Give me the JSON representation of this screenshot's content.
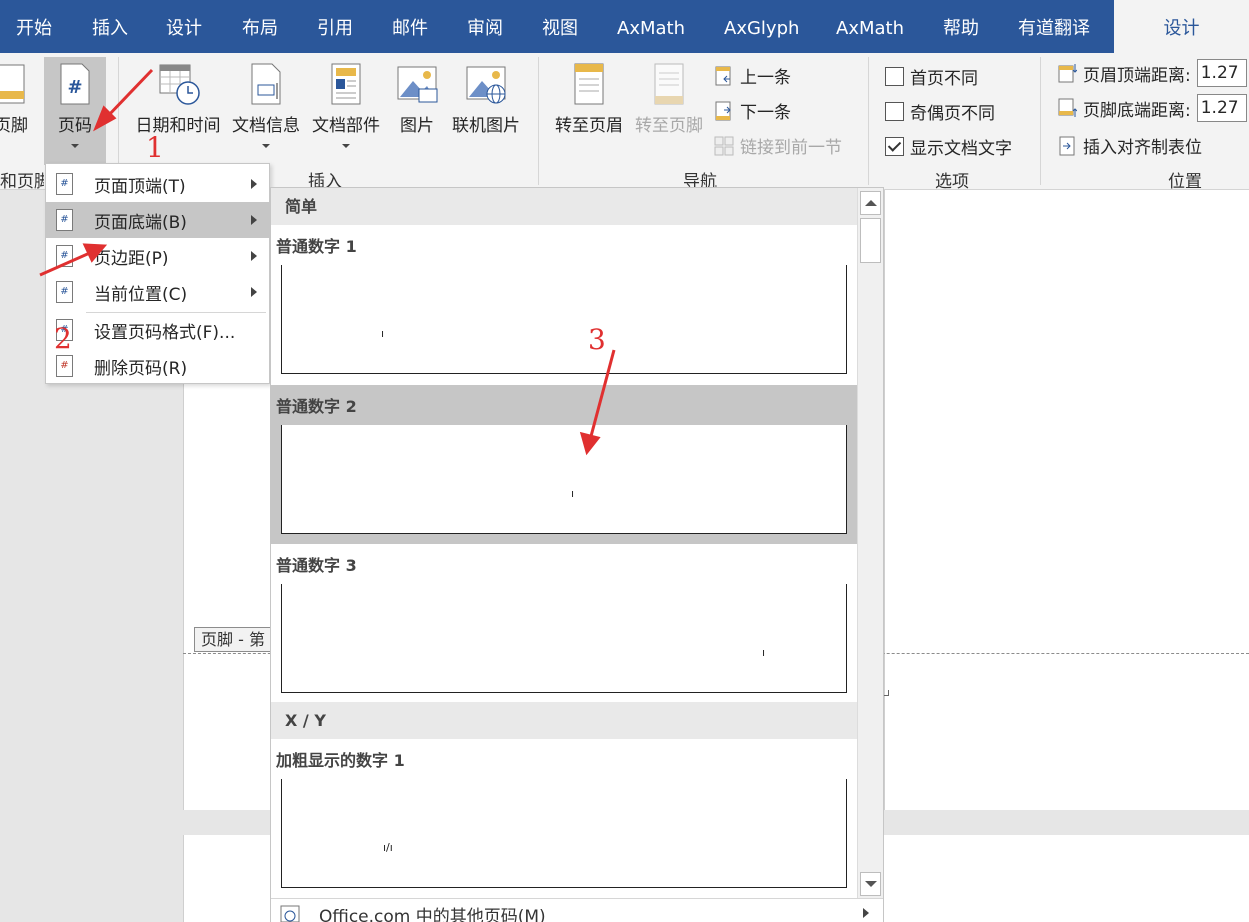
{
  "tabs": [
    {
      "label": "开始",
      "active": false
    },
    {
      "label": "插入",
      "active": false
    },
    {
      "label": "设计",
      "active": false
    },
    {
      "label": "布局",
      "active": false
    },
    {
      "label": "引用",
      "active": false
    },
    {
      "label": "邮件",
      "active": false
    },
    {
      "label": "审阅",
      "active": false
    },
    {
      "label": "视图",
      "active": false
    },
    {
      "label": "AxMath",
      "active": false
    },
    {
      "label": "AxGlyph",
      "active": false
    },
    {
      "label": "AxMath",
      "active": false
    },
    {
      "label": "帮助",
      "active": false
    },
    {
      "label": "有道翻译",
      "active": false
    },
    {
      "label": "设计",
      "active": true
    }
  ],
  "ribbon": {
    "footer_btn": "页脚",
    "page_number_btn": "页码",
    "page_number_icon_glyph": "#",
    "group_header_footer": "和页脚",
    "date_time_btn": "日期和时间",
    "doc_info_btn": "文档信息",
    "doc_parts_btn": "文档部件",
    "picture_btn": "图片",
    "online_picture_btn": "联机图片",
    "group_insert": "插入",
    "goto_header_btn": "转至页眉",
    "goto_footer_btn": "转至页脚",
    "prev_btn": "上一条",
    "next_btn": "下一条",
    "link_prev_btn": "链接到前一节",
    "group_nav": "导航",
    "opt_first_page": "首页不同",
    "opt_odd_even": "奇偶页不同",
    "opt_show_doc_text": "显示文档文字",
    "opt_first_page_checked": false,
    "opt_odd_even_checked": false,
    "opt_show_doc_text_checked": true,
    "group_options": "选项",
    "header_top_label": "页眉顶端距离:",
    "header_top_value": "1.27",
    "footer_bottom_label": "页脚底端距离:",
    "footer_bottom_value": "1.27",
    "insert_align_tab": "插入对齐制表位",
    "group_position": "位置"
  },
  "menu": {
    "items": [
      {
        "label": "页面顶端(T)",
        "submenu": true,
        "highlight": false
      },
      {
        "label": "页面底端(B)",
        "submenu": true,
        "highlight": true
      },
      {
        "label": "页边距(P)",
        "submenu": true,
        "highlight": false
      },
      {
        "label": "当前位置(C)",
        "submenu": true,
        "highlight": false
      },
      {
        "label": "设置页码格式(F)...",
        "submenu": false,
        "highlight": false
      },
      {
        "label": "删除页码(R)",
        "submenu": false,
        "highlight": false
      }
    ]
  },
  "gallery": {
    "section1": "简单",
    "item1": "普通数字 1",
    "item2": "普通数字 2",
    "item3": "普通数字 3",
    "section2": "X / Y",
    "item4": "加粗显示的数字 1",
    "preview_mark": "ı",
    "preview_mark_xy": "ı/ı",
    "footer_item": "Office.com 中的其他页码(M)"
  },
  "document": {
    "footer_tag": "页脚 - 第"
  },
  "annotations": {
    "a1": "1",
    "a2": "2",
    "a3": "3",
    "color": "#e03030"
  },
  "colors": {
    "brand": "#2b579a",
    "ribbon_bg": "#f3f3f3",
    "highlight": "#c6c6c6"
  }
}
